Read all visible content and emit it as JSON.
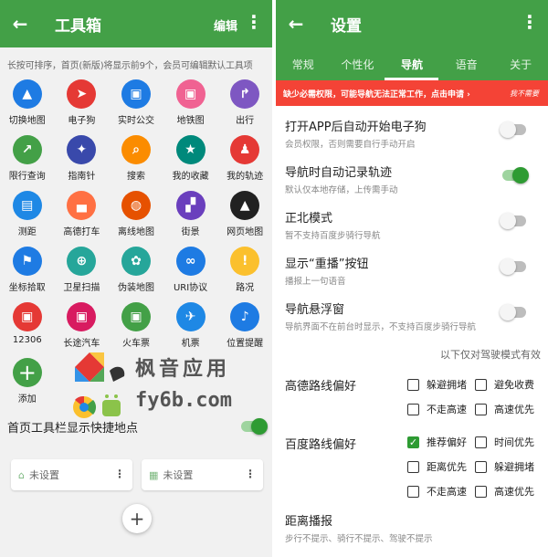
{
  "left": {
    "title": "工具箱",
    "edit_label": "编辑",
    "hint": "长按可排序，首页(新版)将显示前9个，会员可编辑默认工具项",
    "tools": [
      {
        "label": "切换地图",
        "icon": "layers-icon",
        "color": "#1e7be3",
        "glyph": "▲"
      },
      {
        "label": "电子狗",
        "icon": "navigation-arrow-icon",
        "color": "#e53935",
        "glyph": "➤"
      },
      {
        "label": "实时公交",
        "icon": "bus-icon",
        "color": "#1e7be3",
        "glyph": "▣"
      },
      {
        "label": "地铁图",
        "icon": "subway-icon",
        "color": "#f06292",
        "glyph": "▣"
      },
      {
        "label": "出行",
        "icon": "directions-icon",
        "color": "#7e57c2",
        "glyph": "↱"
      },
      {
        "label": "限行查询",
        "icon": "restriction-icon",
        "color": "#43a047",
        "glyph": "↗"
      },
      {
        "label": "指南针",
        "icon": "compass-icon",
        "color": "#3949ab",
        "glyph": "✦"
      },
      {
        "label": "搜索",
        "icon": "search-icon",
        "color": "#fb8c00",
        "glyph": "⌕"
      },
      {
        "label": "我的收藏",
        "icon": "star-icon",
        "color": "#00897b",
        "glyph": "★"
      },
      {
        "label": "我的轨迹",
        "icon": "walking-icon",
        "color": "#e53935",
        "glyph": "♟"
      },
      {
        "label": "测距",
        "icon": "ruler-icon",
        "color": "#1e88e5",
        "glyph": "▤"
      },
      {
        "label": "高德打车",
        "icon": "car-icon",
        "color": "#ff7043",
        "glyph": "▄"
      },
      {
        "label": "离线地图",
        "icon": "globe-icon",
        "color": "#e65100",
        "glyph": "◍"
      },
      {
        "label": "街景",
        "icon": "streetview-icon",
        "color": "#6a3fbd",
        "glyph": "▞"
      },
      {
        "label": "网页地图",
        "icon": "terrain-icon",
        "color": "#212121",
        "glyph": "▲"
      },
      {
        "label": "坐标拾取",
        "icon": "flag-icon",
        "color": "#1e7be3",
        "glyph": "⚑"
      },
      {
        "label": "卫星扫描",
        "icon": "gps-icon",
        "color": "#26a69a",
        "glyph": "⊕"
      },
      {
        "label": "伪装地图",
        "icon": "settings-icon",
        "color": "#26a69a",
        "glyph": "✿"
      },
      {
        "label": "URI协议",
        "icon": "infinity-icon",
        "color": "#1e7be3",
        "glyph": "∞"
      },
      {
        "label": "路况",
        "icon": "warning-icon",
        "color": "#fbc02d",
        "glyph": "!"
      },
      {
        "label": "12306",
        "icon": "train-icon",
        "color": "#e53935",
        "glyph": "▣"
      },
      {
        "label": "长途汽车",
        "icon": "coach-icon",
        "color": "#d81b60",
        "glyph": "▣"
      },
      {
        "label": "火车票",
        "icon": "train-ticket-icon",
        "color": "#43a047",
        "glyph": "▣"
      },
      {
        "label": "机票",
        "icon": "airplane-icon",
        "color": "#1e88e5",
        "glyph": "✈"
      },
      {
        "label": "位置提醒",
        "icon": "bell-icon",
        "color": "#1e7be3",
        "glyph": "♪"
      },
      {
        "label": "添加",
        "icon": "plus-icon",
        "color": "#43a047",
        "glyph": "+"
      }
    ],
    "quick_label": "首页工具栏显示快捷地点",
    "cards": [
      {
        "label": "未设置",
        "icon": "home-icon",
        "glyph": "⌂"
      },
      {
        "label": "未设置",
        "icon": "company-icon",
        "glyph": "▦"
      }
    ],
    "watermark": {
      "line1": "枫音应用",
      "line2": "fy6b.com"
    }
  },
  "right": {
    "title": "设置",
    "tabs": [
      "常规",
      "个性化",
      "导航",
      "语音",
      "关于"
    ],
    "active_tab": 2,
    "warning": "缺少必需权限，可能导航无法正常工作，点击申请 ›",
    "warning_btn": "我不需要",
    "settings": [
      {
        "title": "打开APP后自动开始电子狗",
        "sub": "会员权限，否则需要自行手动开启",
        "on": false
      },
      {
        "title": "导航时自动记录轨迹",
        "sub": "默认仅本地存储，上传需手动",
        "on": true
      },
      {
        "title": "正北模式",
        "sub": "暂不支持百度步骑行导航",
        "on": false
      },
      {
        "title": "显示“重播”按钮",
        "sub": "播报上一句语音",
        "on": false
      },
      {
        "title": "导航悬浮窗",
        "sub": "导航界面不在前台时显示，不支持百度步骑行导航",
        "on": false
      }
    ],
    "note": "以下仅对驾驶模式有效",
    "gaode": {
      "title": "高德路线偏好",
      "options": [
        {
          "label": "躲避拥堵",
          "checked": false
        },
        {
          "label": "避免收费",
          "checked": false
        },
        {
          "label": "不走高速",
          "checked": false
        },
        {
          "label": "高速优先",
          "checked": false
        }
      ]
    },
    "baidu": {
      "title": "百度路线偏好",
      "options": [
        {
          "label": "推荐偏好",
          "checked": true
        },
        {
          "label": "时间优先",
          "checked": false
        },
        {
          "label": "距离优先",
          "checked": false
        },
        {
          "label": "躲避拥堵",
          "checked": false
        },
        {
          "label": "不走高速",
          "checked": false
        },
        {
          "label": "高速优先",
          "checked": false
        }
      ]
    },
    "distance": {
      "title": "距离播报",
      "sub": "步行不提示、骑行不提示、驾驶不提示"
    }
  }
}
